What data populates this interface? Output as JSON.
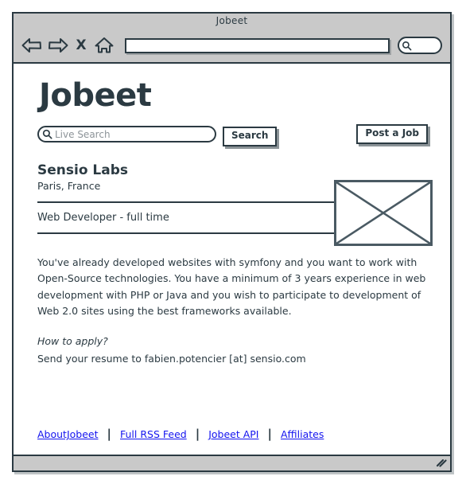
{
  "browser": {
    "window_title": "Jobeet",
    "url_value": "",
    "url_placeholder": "",
    "back_icon": "back-arrow-icon",
    "forward_icon": "forward-arrow-icon",
    "stop_label": "X",
    "home_icon": "home-icon",
    "search_icon": "search-icon",
    "chrome_search_value": ""
  },
  "site": {
    "logo": "Jobeet"
  },
  "search": {
    "live_search_placeholder": "Live Search",
    "live_search_value": "",
    "search_button": "Search",
    "post_job_button": "Post a Job"
  },
  "job": {
    "company": "Sensio Labs",
    "location": "Paris, France",
    "title": "Web Developer - full time",
    "logo_alt": "image-placeholder",
    "description": "You've already developed websites with symfony and you want to work with Open-Source technologies. You have a minimum of 3 years experience in web development with PHP or Java and you wish to participate to development of Web 2.0 sites using the best frameworks available.",
    "how_to_apply_heading": "How to apply?",
    "how_to_apply_text": "Send your resume to fabien.potencier [at] sensio.com"
  },
  "footer": {
    "links": [
      {
        "label": "AboutJobeet"
      },
      {
        "label": "Full RSS Feed"
      },
      {
        "label": "Jobeet API"
      },
      {
        "label": "Affiliates"
      }
    ],
    "separator": "|"
  },
  "statusbar": {
    "grip_icon": "resize-grip-icon"
  },
  "colors": {
    "ink": "#2b3a42",
    "chrome": "#c9c9c9",
    "link": "#1414ef",
    "placeholder": "#8d9499"
  }
}
